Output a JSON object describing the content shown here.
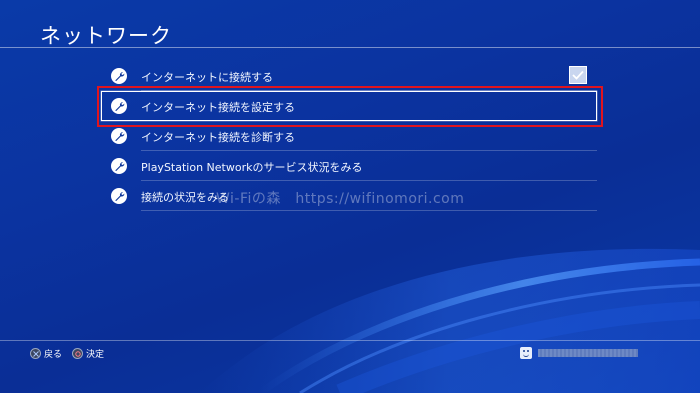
{
  "header": {
    "title": "ネットワーク"
  },
  "menu": {
    "items": [
      {
        "label": "インターネットに接続する",
        "icon": "wrench-icon",
        "checked": true
      },
      {
        "label": "インターネット接続を設定する",
        "icon": "wrench-icon",
        "selected": true
      },
      {
        "label": "インターネット接続を診断する",
        "icon": "wrench-icon"
      },
      {
        "label": "PlayStation Networkのサービス状況をみる",
        "icon": "wrench-icon"
      },
      {
        "label": "接続の状況をみる",
        "icon": "wrench-icon"
      }
    ]
  },
  "watermark": "Wi-Fiの森　https://wifinomori.com",
  "footer": {
    "back_label": "戻る",
    "confirm_label": "決定"
  },
  "colors": {
    "background": "#0b33a0",
    "highlight_border": "#e0141e",
    "text": "#ffffff"
  }
}
